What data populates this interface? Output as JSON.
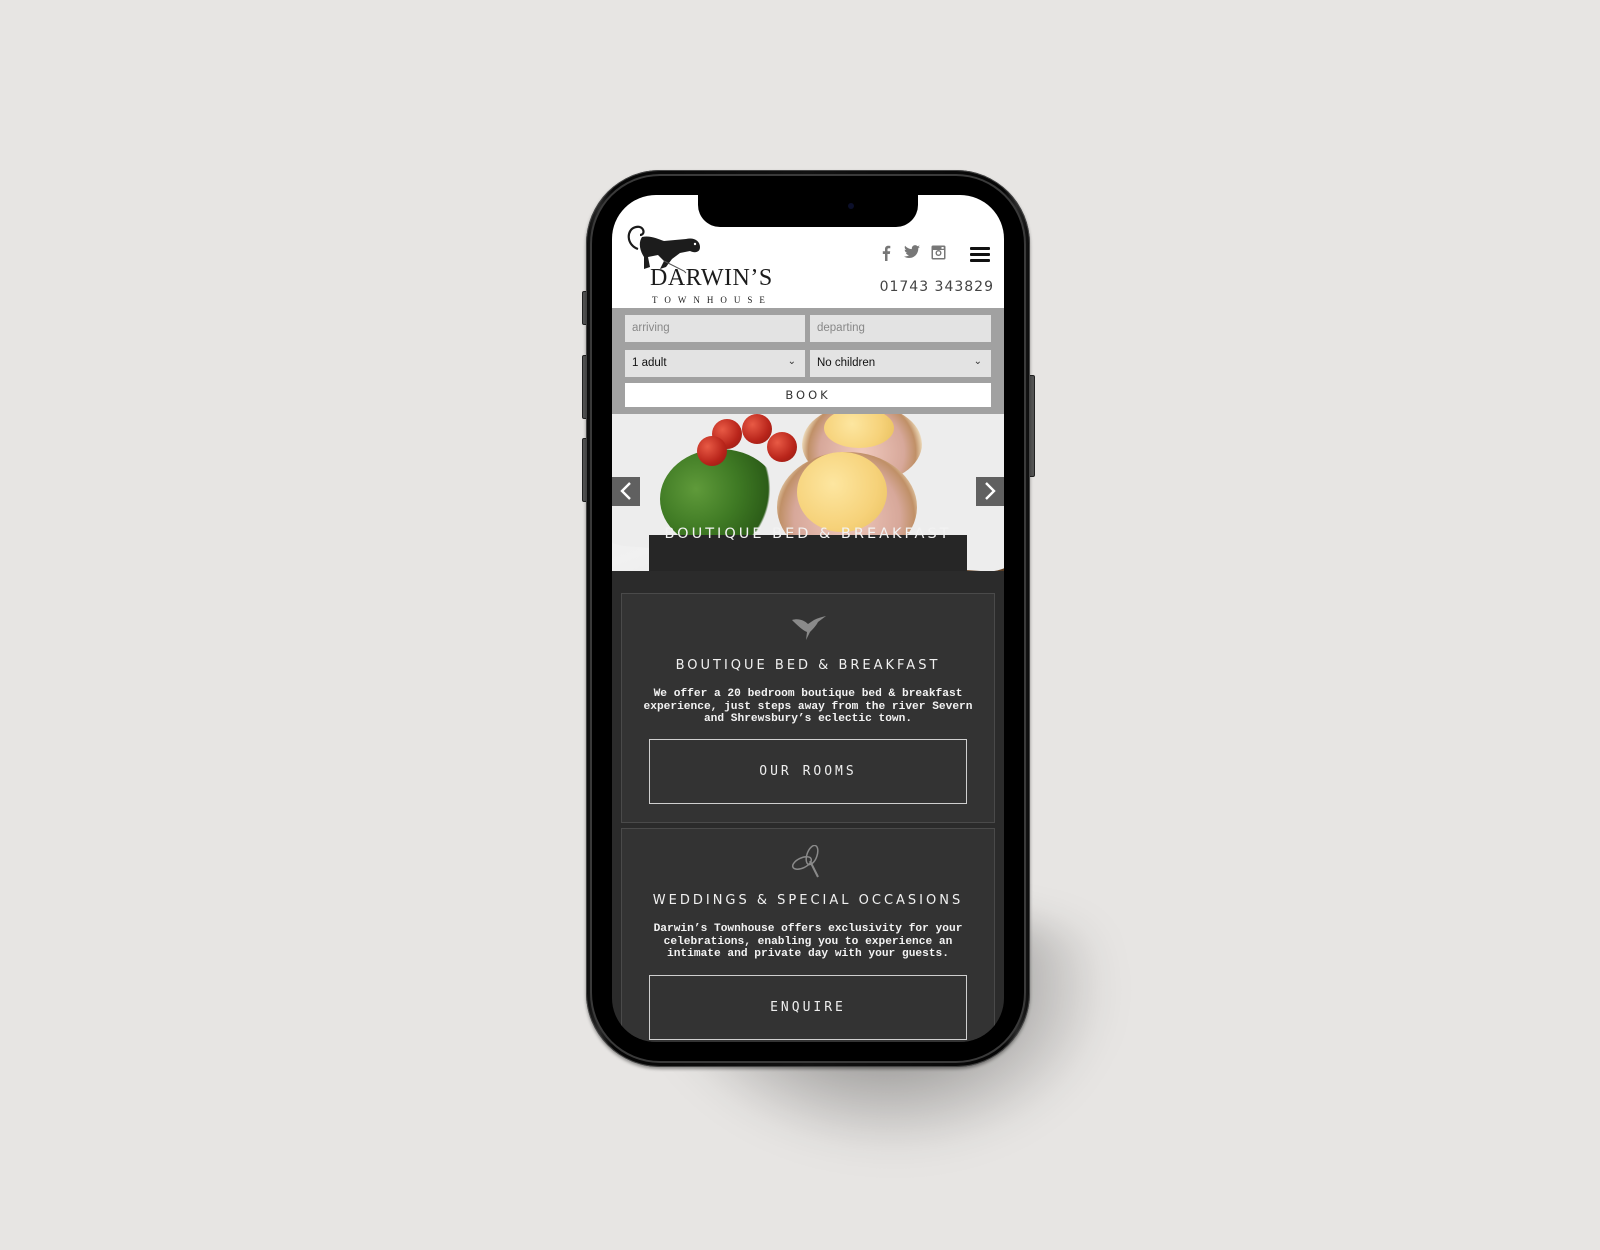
{
  "header": {
    "brand_name": "DARWIN’S",
    "brand_sub": "TOWNHOUSE",
    "phone": "01743 343829",
    "social_icons": [
      "facebook-icon",
      "twitter-icon",
      "instagram-icon"
    ],
    "menu_icon": "hamburger-menu-icon"
  },
  "booking": {
    "arriving_placeholder": "arriving",
    "departing_placeholder": "departing",
    "adults_value": "1 adult",
    "children_value": "No children",
    "book_label": "BOOK"
  },
  "carousel": {
    "caption": "BOUTIQUE BED & BREAKFAST",
    "prev_icon": "chevron-left-icon",
    "next_icon": "chevron-right-icon"
  },
  "cards": [
    {
      "icon": "hummingbird-icon",
      "title": "BOUTIQUE BED & BREAKFAST",
      "body": "We offer a 20 bedroom boutique bed & breakfast experience, just steps away from the river Severn and Shrewsbury’s eclectic town.",
      "cta": "OUR ROOMS"
    },
    {
      "icon": "dragonfly-icon",
      "title": "WEDDINGS & SPECIAL OCCASIONS",
      "body": "Darwin’s Townhouse offers exclusivity for your celebrations, enabling you to experience an intimate and private day with your guests.",
      "cta": "ENQUIRE"
    }
  ]
}
